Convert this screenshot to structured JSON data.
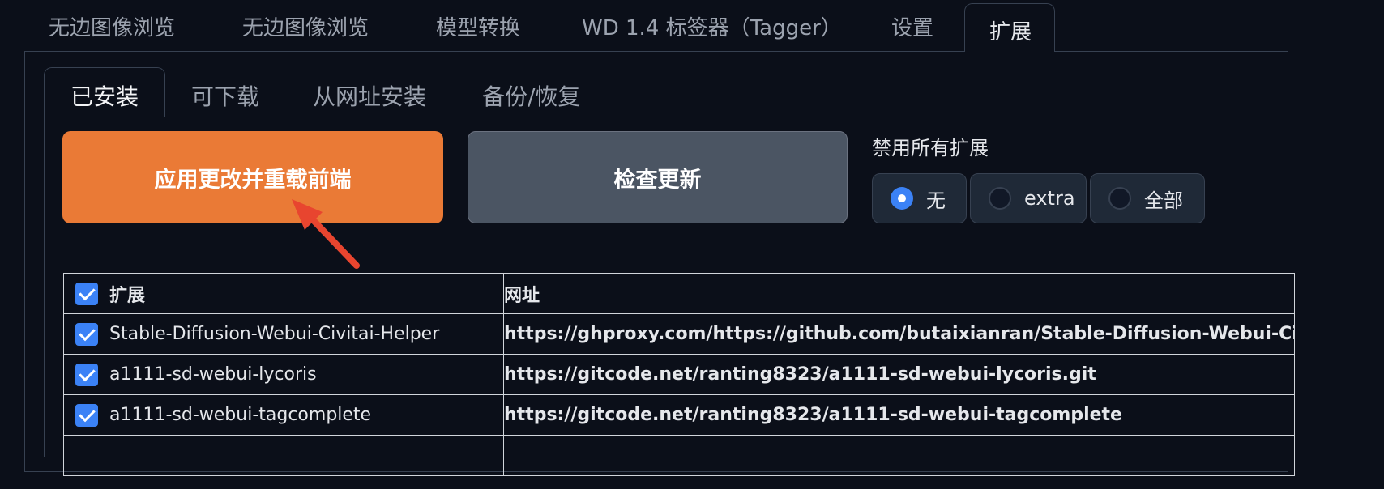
{
  "top_tabs": [
    {
      "label": "无边图像浏览"
    },
    {
      "label": "无边图像浏览"
    },
    {
      "label": "模型转换"
    },
    {
      "label": "WD 1.4 标签器（Tagger）"
    },
    {
      "label": "设置"
    },
    {
      "label": "扩展",
      "active": true
    }
  ],
  "sub_tabs": [
    {
      "label": "已安装",
      "active": true
    },
    {
      "label": "可下载"
    },
    {
      "label": "从网址安装"
    },
    {
      "label": "备份/恢复"
    }
  ],
  "buttons": {
    "apply_label": "应用更改并重载前端",
    "check_label": "检查更新"
  },
  "disable_extensions": {
    "label": "禁用所有扩展",
    "options": [
      "无",
      "extra",
      "全部"
    ],
    "selected": "无"
  },
  "table": {
    "headers": [
      "扩展",
      "网址"
    ],
    "rows": [
      {
        "name": "Stable-Diffusion-Webui-Civitai-Helper",
        "url": "https://ghproxy.com/https://github.com/butaixianran/Stable-Diffusion-Webui-Civitai",
        "checked": true
      },
      {
        "name": "a1111-sd-webui-lycoris",
        "url": "https://gitcode.net/ranting8323/a1111-sd-webui-lycoris.git",
        "checked": true
      },
      {
        "name": "a1111-sd-webui-tagcomplete",
        "url": "https://gitcode.net/ranting8323/a1111-sd-webui-tagcomplete",
        "checked": true
      }
    ]
  },
  "colors": {
    "accent_orange": "#ea7a36",
    "annotation_arrow": "#e8452f",
    "checkbox_blue": "#3b82f6"
  }
}
